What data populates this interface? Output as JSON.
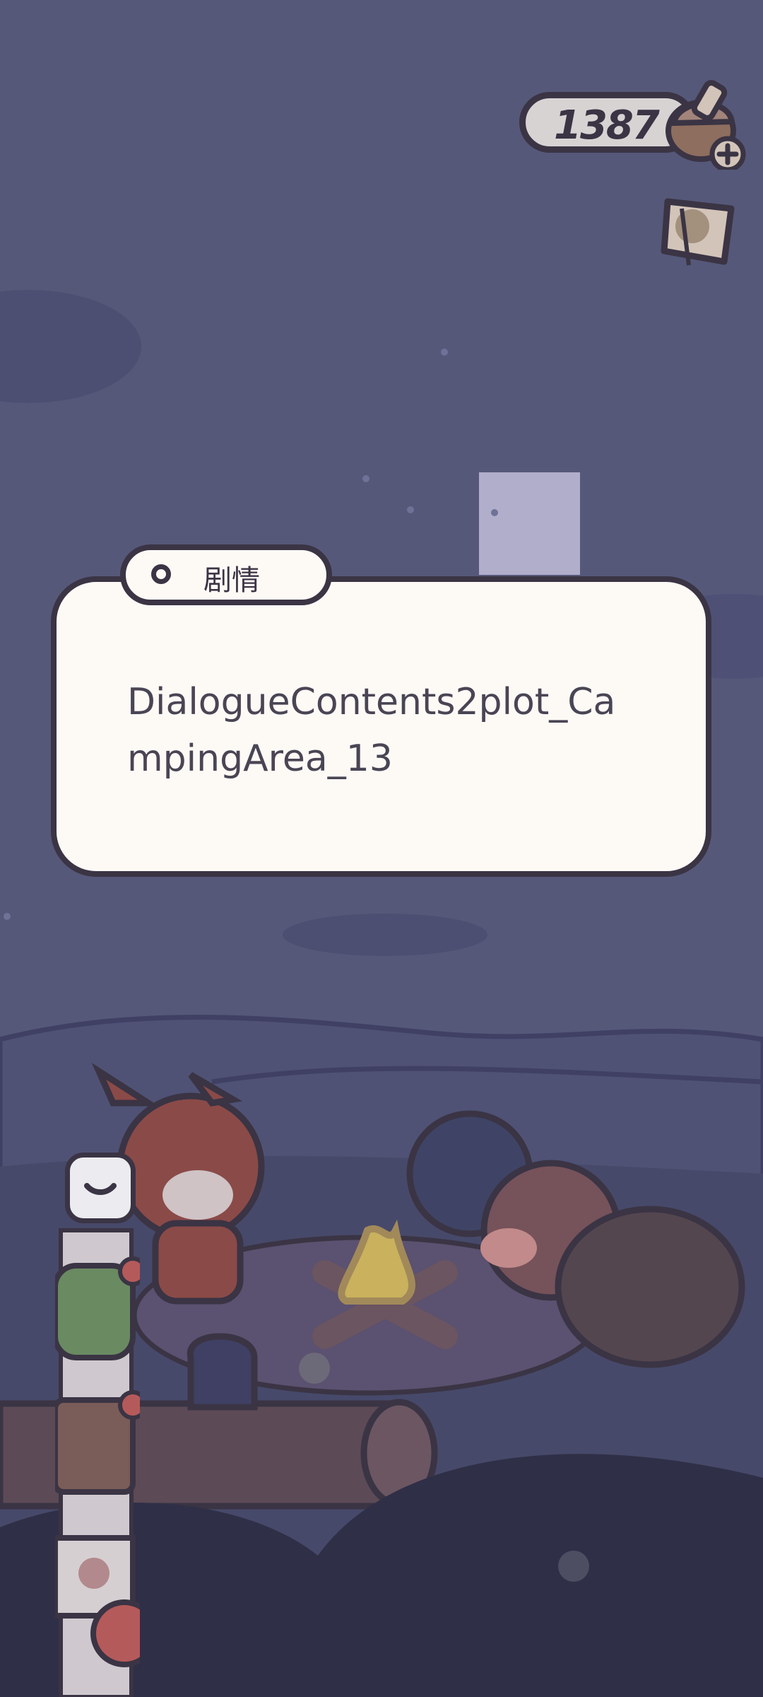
{
  "hud": {
    "currency_value": "1387",
    "currency_icon": "acorn-icon",
    "add_icon": "plus-icon",
    "side_button_icon": "ticket-icon"
  },
  "dialogue": {
    "tab_label": "剧情",
    "text": "DialogueContents2plot_CampingArea_13"
  },
  "inventory": {
    "toggle_icon": "chevron-down-icon",
    "items": [
      "backpack-icon",
      "notebook-icon",
      "map-icon",
      "apple-icon"
    ]
  },
  "colors": {
    "sky": "#555879",
    "panel": "#fdfaf6",
    "outline": "#3a3444",
    "pill": "#d8d3d3"
  }
}
